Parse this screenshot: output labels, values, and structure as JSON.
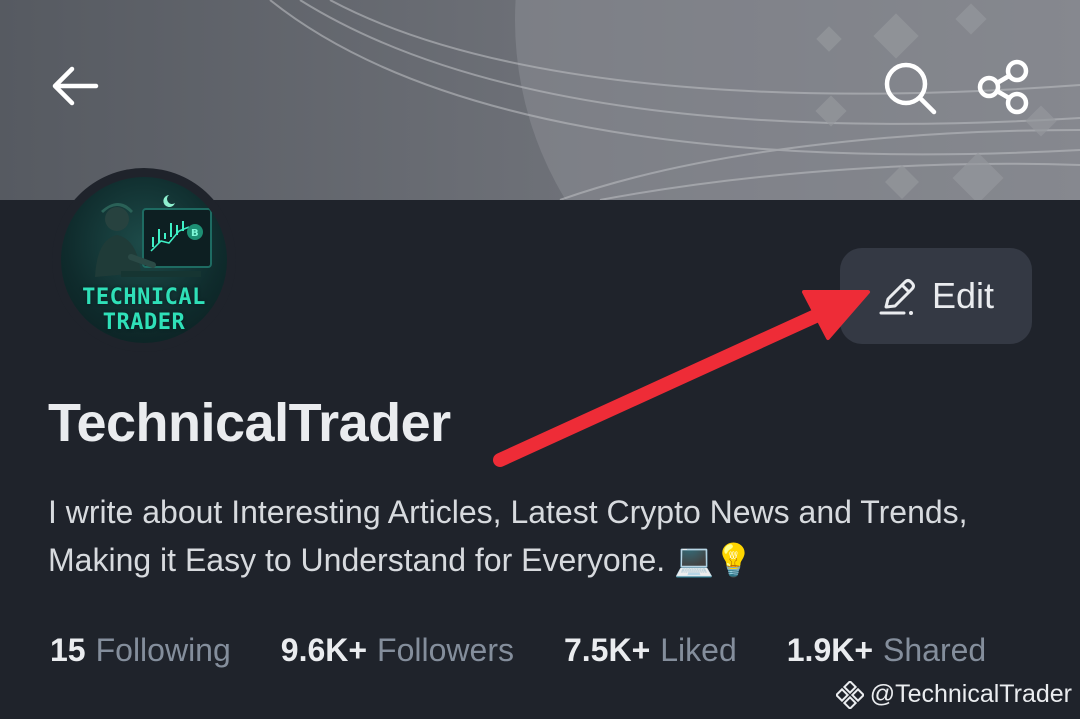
{
  "profile": {
    "avatar_text_line1": "TECHNICAL",
    "avatar_text_line2": "TRADER",
    "name": "TechnicalTrader",
    "bio": "I write about Interesting Articles, Latest Crypto News and Trends, Making it Easy to Understand for Everyone. 💻💡"
  },
  "actions": {
    "edit_label": "Edit"
  },
  "stats": [
    {
      "value": "15",
      "label": "Following"
    },
    {
      "value": "9.6K+",
      "label": "Followers"
    },
    {
      "value": "7.5K+",
      "label": "Liked"
    },
    {
      "value": "1.9K+",
      "label": "Shared"
    }
  ],
  "watermark": {
    "handle": "@TechnicalTrader"
  },
  "icons": {
    "back": "arrow-left-icon",
    "search": "search-icon",
    "share": "share-icon",
    "edit": "pencil-icon",
    "watermark": "binance-logo-icon"
  },
  "colors": {
    "background": "#1f232b",
    "button": "#343944",
    "annotation_arrow": "#ee2c37",
    "muted_text": "#848e9c",
    "avatar_text": "#2fe0b8"
  }
}
